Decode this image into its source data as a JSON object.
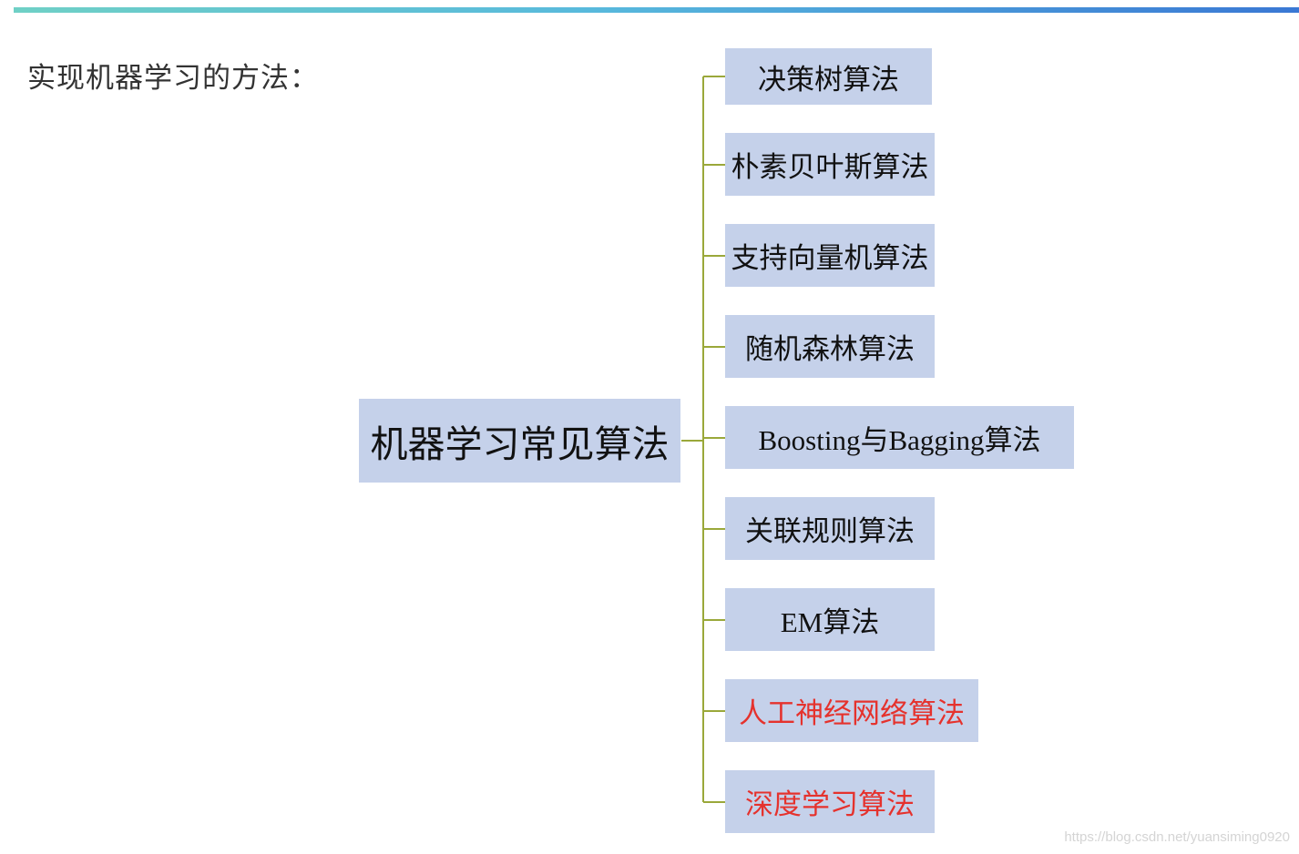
{
  "page": {
    "title": "实现机器学习的方法："
  },
  "diagram": {
    "root": "机器学习常见算法",
    "branches": [
      {
        "label": "决策树算法",
        "highlight": false
      },
      {
        "label": "朴素贝叶斯算法",
        "highlight": false
      },
      {
        "label": "支持向量机算法",
        "highlight": false
      },
      {
        "label": "随机森林算法",
        "highlight": false
      },
      {
        "label": "Boosting与Bagging算法",
        "highlight": false
      },
      {
        "label": "关联规则算法",
        "highlight": false
      },
      {
        "label": "EM算法",
        "highlight": false
      },
      {
        "label": "人工神经网络算法",
        "highlight": true
      },
      {
        "label": "深度学习算法",
        "highlight": true
      }
    ]
  },
  "colors": {
    "node_fill": "#c5d1ea",
    "connector": "#9aa83a",
    "highlight_text": "#e5322d",
    "top_bar_start": "#6fd0c6",
    "top_bar_end": "#3a78d4"
  },
  "watermark": "https://blog.csdn.net/yuansiming0920"
}
